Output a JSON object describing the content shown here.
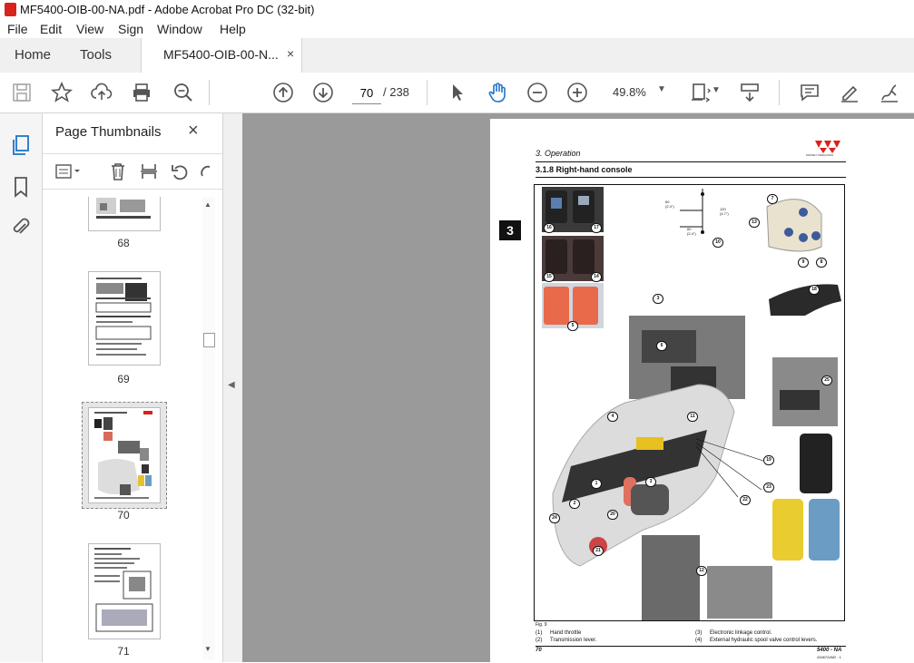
{
  "window": {
    "title": "MF5400-OIB-00-NA.pdf - Adobe Acrobat Pro DC (32-bit)"
  },
  "menu": [
    "File",
    "Edit",
    "View",
    "Sign",
    "Window",
    "Help"
  ],
  "tabs": {
    "home": "Home",
    "tools": "Tools",
    "document": "MF5400-OIB-00-N...",
    "close": "×"
  },
  "toolbar": {
    "page_current": "70",
    "page_total": "/  238",
    "zoom": "49.8%",
    "icons": [
      "save-icon",
      "bookmark-star-icon",
      "upload-icon",
      "print-icon",
      "zoom-search-icon",
      "prev-page-icon",
      "next-page-icon",
      "select-cursor-icon",
      "hand-icon",
      "zoom-out-icon",
      "zoom-in-icon",
      "fit-page-icon",
      "scroll-mode-icon",
      "comment-icon",
      "highlight-pen-icon",
      "sign-icon"
    ]
  },
  "panel": {
    "title": "Page Thumbnails",
    "close": "×",
    "thumbnails": [
      {
        "label": "68"
      },
      {
        "label": "69"
      },
      {
        "label": "70",
        "selected": true
      },
      {
        "label": "71"
      }
    ]
  },
  "pdf_page": {
    "section": "3. Operation",
    "heading": "3.1.8     Right-hand console",
    "brand": "MASSEY FERGUSON",
    "chapter_tab": "3",
    "fig": "Fig. 9",
    "callouts": [
      "16",
      "17",
      "15",
      "14",
      "5",
      "60\n(2.4\")",
      "120\n(4.7\")",
      "60\n(2.4\")",
      "10",
      "7",
      "13",
      "9",
      "8",
      "3",
      "18",
      "6",
      "25",
      "4",
      "11",
      "19",
      "1",
      "23",
      "3",
      "22",
      "2",
      "20",
      "24",
      "21",
      "12"
    ],
    "captions": [
      {
        "num": "(1)",
        "text": "Hand throttle"
      },
      {
        "num": "(2)",
        "text": "Transmission lever."
      },
      {
        "num": "(3)",
        "text": "Electronic linkage control."
      },
      {
        "num": "(4)",
        "text": "External hydraulic spool valve control levers."
      }
    ],
    "page_number": "70",
    "footer_model": "5400 - NA",
    "footer_code": "4346724M2 - 1"
  },
  "colors": {
    "accent": "#d8221b",
    "doc_bg": "#9a9a9a",
    "toolbar_icon": "#555555"
  }
}
